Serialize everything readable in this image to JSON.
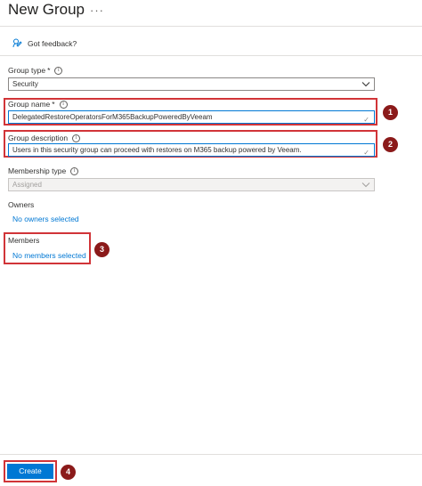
{
  "header": {
    "title": "New Group",
    "more": "···",
    "feedback": "Got feedback?"
  },
  "form": {
    "group_type": {
      "label": "Group type",
      "required": "*",
      "value": "Security"
    },
    "group_name": {
      "label": "Group name",
      "required": "*",
      "value": "DelegatedRestoreOperatorsForM365BackupPoweredByVeeam"
    },
    "group_description": {
      "label": "Group description",
      "value": "Users in this security group can proceed with restores on M365 backup powered by Veeam."
    },
    "membership_type": {
      "label": "Membership type",
      "value": "Assigned"
    },
    "owners": {
      "label": "Owners",
      "link": "No owners selected"
    },
    "members": {
      "label": "Members",
      "link": "No members selected"
    }
  },
  "footer": {
    "create_label": "Create"
  },
  "callouts": [
    "1",
    "2",
    "3",
    "4"
  ],
  "colors": {
    "accent": "#0078d4",
    "highlight": "#d13438",
    "badge": "#8b1a1a"
  },
  "icons": [
    "more-icon",
    "feedback-icon",
    "info-icon",
    "chevron-down-icon",
    "checkmark-icon"
  ]
}
